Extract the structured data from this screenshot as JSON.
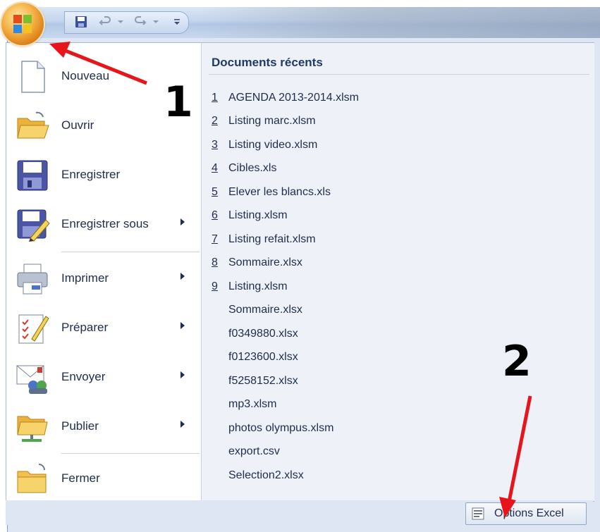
{
  "quick_access": {
    "icons": [
      "save-icon",
      "undo-icon",
      "redo-icon",
      "customize-icon"
    ]
  },
  "menu": {
    "commands": [
      {
        "label": "Nouveau",
        "icon": "new-document-icon",
        "submenu": false
      },
      {
        "label": "Ouvrir",
        "icon": "open-folder-icon",
        "submenu": false
      },
      {
        "label": "Enregistrer",
        "icon": "save-icon",
        "submenu": false
      },
      {
        "label": "Enregistrer sous",
        "icon": "save-as-icon",
        "submenu": true
      },
      {
        "label": "Imprimer",
        "icon": "printer-icon",
        "submenu": true
      },
      {
        "label": "Préparer",
        "icon": "prepare-icon",
        "submenu": true
      },
      {
        "label": "Envoyer",
        "icon": "send-icon",
        "submenu": true
      },
      {
        "label": "Publier",
        "icon": "publish-icon",
        "submenu": true
      },
      {
        "label": "Fermer",
        "icon": "close-folder-icon",
        "submenu": false
      }
    ]
  },
  "recent": {
    "title": "Documents récents",
    "documents": [
      {
        "num": "1",
        "name": "AGENDA 2013-2014.xlsm"
      },
      {
        "num": "2",
        "name": "Listing marc.xlsm"
      },
      {
        "num": "3",
        "name": "Listing video.xlsm"
      },
      {
        "num": "4",
        "name": "Cibles.xls"
      },
      {
        "num": "5",
        "name": "Elever les blancs.xls"
      },
      {
        "num": "6",
        "name": "Listing.xlsm"
      },
      {
        "num": "7",
        "name": "Listing refait.xlsm"
      },
      {
        "num": "8",
        "name": "Sommaire.xlsx"
      },
      {
        "num": "9",
        "name": "Listing.xlsm"
      },
      {
        "num": "",
        "name": "Sommaire.xlsx"
      },
      {
        "num": "",
        "name": "f0349880.xlsx"
      },
      {
        "num": "",
        "name": "f0123600.xlsx"
      },
      {
        "num": "",
        "name": "f5258152.xlsx"
      },
      {
        "num": "",
        "name": "mp3.xlsm"
      },
      {
        "num": "",
        "name": "photos olympus.xlsm"
      },
      {
        "num": "",
        "name": "export.csv"
      },
      {
        "num": "",
        "name": "Selection2.xlsx"
      }
    ]
  },
  "footer": {
    "options_label": "Options Excel"
  },
  "annotations": {
    "step1": "1",
    "step2": "2",
    "arrow_color": "#e8141b"
  }
}
